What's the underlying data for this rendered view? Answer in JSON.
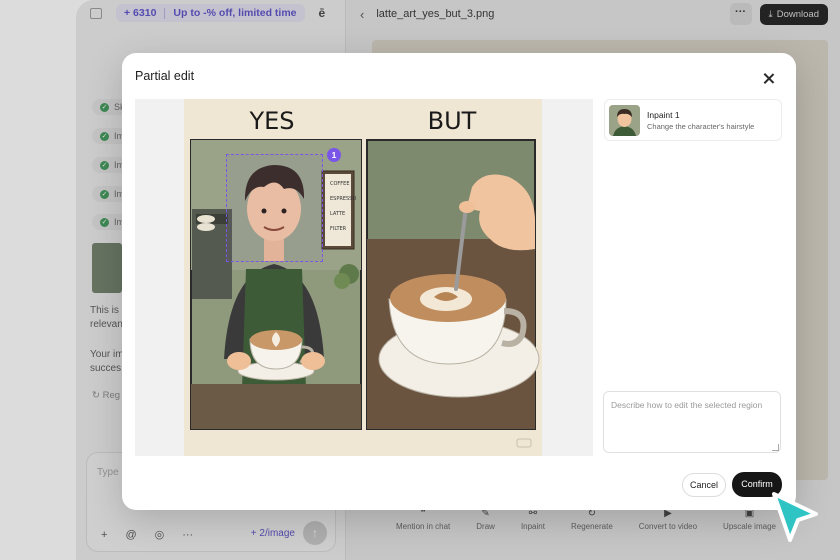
{
  "app": {
    "promo_credits": "+ 6310",
    "promo_offer": "Up to -% off, limited time",
    "chips": [
      "Skil",
      "Ima",
      "Ima",
      "Ima",
      "Ima"
    ],
    "left_text_1": "This is",
    "left_text_2": "relevan",
    "left_text_3": "Your im",
    "left_text_4": "succes",
    "regenerate": "Reg",
    "composer_placeholder": "Type",
    "composer_rate": "+ 2/image",
    "file_name": "latte_art_yes_but_3.png",
    "download_label": "Download",
    "bottom_actions": [
      {
        "icon": "quote-icon",
        "label": "Mention in chat"
      },
      {
        "icon": "draw-icon",
        "label": "Draw"
      },
      {
        "icon": "inpaint-icon",
        "label": "Inpaint"
      },
      {
        "icon": "regenerate-icon",
        "label": "Regenerate"
      },
      {
        "icon": "video-icon",
        "label": "Convert to video"
      },
      {
        "icon": "upscale-icon",
        "label": "Upscale image"
      }
    ]
  },
  "modal": {
    "title": "Partial edit",
    "image": {
      "left_label": "YES",
      "right_label": "BUT",
      "menu_lines": [
        "COFFEE",
        "ESPRESSO",
        "LATTE",
        "FILTER"
      ],
      "selection_number": "1"
    },
    "inpaint_item": {
      "name": "Inpaint 1",
      "description": "Change the character's hairstyle"
    },
    "input_placeholder": "Describe how to edit the selected region",
    "cancel_label": "Cancel",
    "confirm_label": "Confirm"
  },
  "colors": {
    "accent": "#7a56e8",
    "primary_button": "#161616",
    "cursor": "#2ec4c4"
  }
}
